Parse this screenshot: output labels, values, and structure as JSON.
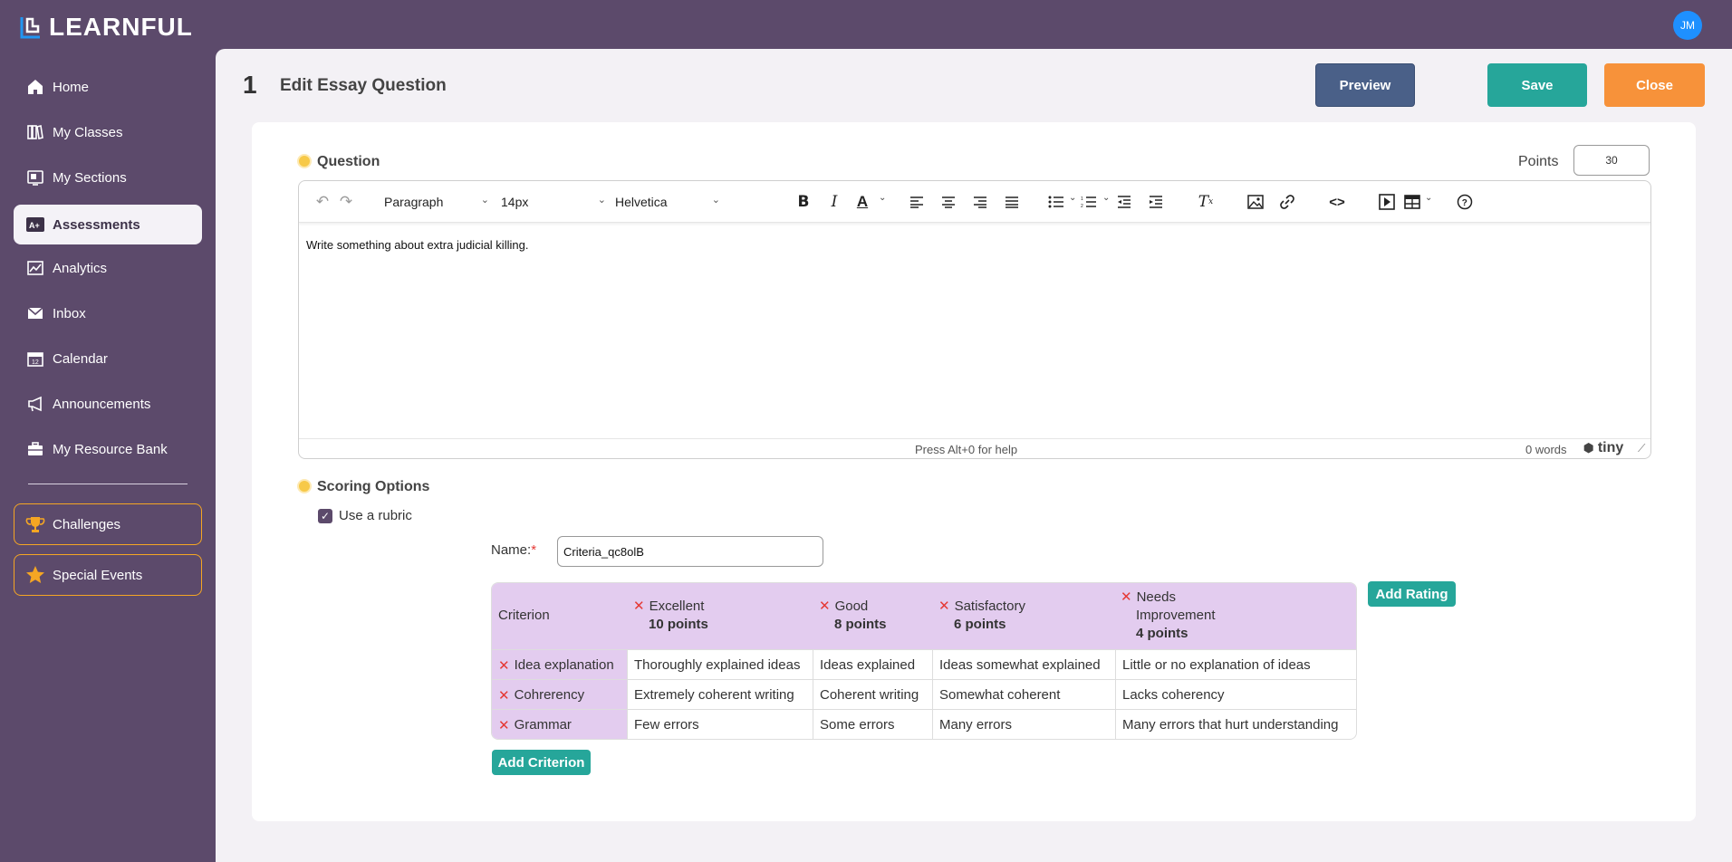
{
  "app": {
    "name": "LEARNFUL",
    "user_initials": "JM"
  },
  "sidebar": {
    "items": [
      {
        "label": "Home",
        "icon": "home-icon"
      },
      {
        "label": "My Classes",
        "icon": "books-icon"
      },
      {
        "label": "My Sections",
        "icon": "sections-icon"
      },
      {
        "label": "Assessments",
        "icon": "assessment-icon",
        "active": true
      },
      {
        "label": "Analytics",
        "icon": "chart-icon"
      },
      {
        "label": "Inbox",
        "icon": "mail-icon"
      },
      {
        "label": "Calendar",
        "icon": "calendar-icon"
      },
      {
        "label": "Announcements",
        "icon": "megaphone-icon"
      },
      {
        "label": "My Resource Bank",
        "icon": "briefcase-icon"
      }
    ],
    "special": [
      {
        "label": "Challenges",
        "icon": "trophy-icon"
      },
      {
        "label": "Special Events",
        "icon": "star-icon"
      }
    ]
  },
  "header": {
    "number": "1",
    "title": "Edit Essay Question",
    "preview_label": "Preview",
    "save_label": "Save",
    "close_label": "Close"
  },
  "question": {
    "section_title": "Question",
    "points_label": "Points",
    "points_value": "30",
    "editor": {
      "block_format": "Paragraph",
      "font_size": "14px",
      "font_family": "Helvetica",
      "content": "Write something about extra judicial killing.",
      "help_text": "Press Alt+0 for help",
      "word_count": "0 words",
      "brand": "tiny"
    }
  },
  "scoring": {
    "section_title": "Scoring Options",
    "use_rubric_label": "Use a rubric",
    "use_rubric_checked": true,
    "name_label": "Name:",
    "name_required": "*",
    "name_value": "Criteria_qc8olB",
    "criterion_header": "Criterion",
    "ratings": [
      {
        "name": "Excellent",
        "points": "10 points"
      },
      {
        "name": "Good",
        "points": "8 points"
      },
      {
        "name": "Satisfactory",
        "points": "6 points"
      },
      {
        "name_line1": "Needs",
        "name_line2": "Improvement",
        "points": "4 points"
      }
    ],
    "criteria": [
      {
        "name": "Idea explanation",
        "cells": [
          "Thoroughly explained ideas",
          "Ideas explained",
          "Ideas somewhat explained",
          "Little or no explanation of ideas"
        ]
      },
      {
        "name": "Cohrerency",
        "cells": [
          "Extremely coherent writing",
          "Coherent writing",
          "Somewhat coherent",
          "Lacks coherency"
        ]
      },
      {
        "name": "Grammar",
        "cells": [
          "Few errors",
          "Some errors",
          "Many errors",
          "Many errors that hurt understanding"
        ]
      }
    ],
    "add_rating_label": "Add Rating",
    "add_criterion_label": "Add Criterion"
  },
  "colors": {
    "sidebar_bg": "#5c4a6b",
    "accent_teal": "#26a69a",
    "accent_orange": "#f7923a",
    "preview_blue": "#4a6088",
    "rubric_header": "#e3ccef"
  }
}
